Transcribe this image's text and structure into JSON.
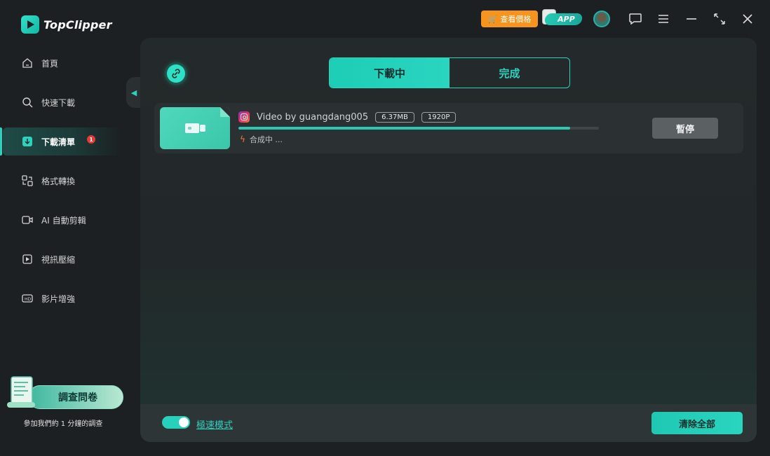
{
  "app": {
    "name": "TopClipper"
  },
  "titlebar": {
    "price_label": "查看價格",
    "app_label": "APP"
  },
  "sidebar": {
    "items": [
      {
        "label": "首頁",
        "icon": "home-icon"
      },
      {
        "label": "快速下載",
        "icon": "search-icon"
      },
      {
        "label": "下載清單",
        "icon": "download-list-icon",
        "active": true,
        "badge": "1"
      },
      {
        "label": "格式轉換",
        "icon": "format-convert-icon"
      },
      {
        "label": "AI 自動剪輯",
        "icon": "ai-edit-icon"
      },
      {
        "label": "視訊壓縮",
        "icon": "video-compress-icon"
      },
      {
        "label": "影片增強",
        "icon": "video-enhance-icon"
      }
    ],
    "survey": {
      "button_label": "調查問卷",
      "note": "參加我們約 1 分鐘的調查"
    }
  },
  "main": {
    "tabs": [
      {
        "label": "下載中",
        "active": true
      },
      {
        "label": "完成",
        "active": false
      }
    ],
    "downloads": [
      {
        "source_icon": "instagram-icon",
        "title": "Video by guangdang005",
        "size": "6.37MB",
        "resolution": "1920P",
        "progress": 0.92,
        "status": "合成中 ...",
        "action_label": "暫停"
      }
    ],
    "footer": {
      "turbo_label": "極速模式",
      "turbo_on": true,
      "clear_label": "清除全部"
    }
  },
  "colors": {
    "accent": "#2fd1bd",
    "price_orange": "#f7941d",
    "badge_red": "#e53935"
  }
}
